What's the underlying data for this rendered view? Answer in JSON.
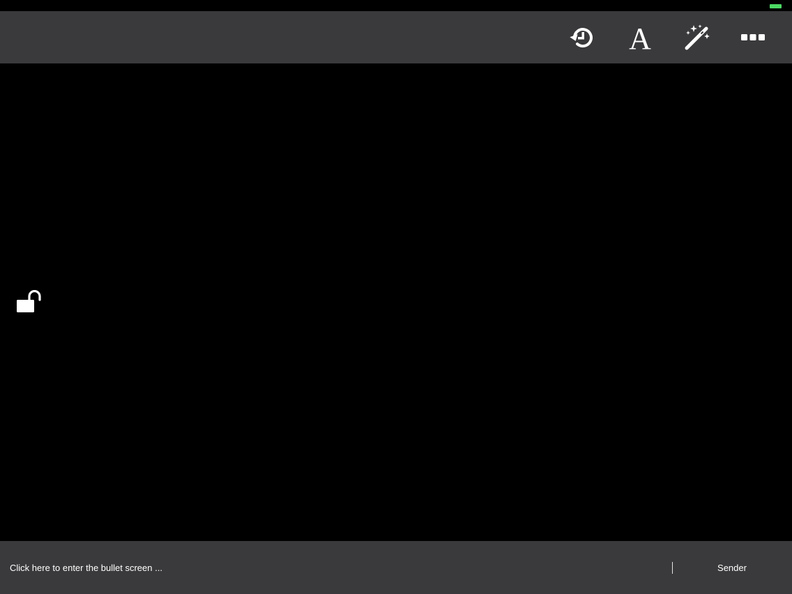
{
  "status_bar": {
    "battery_color": "#4cd964"
  },
  "toolbar": {
    "buttons": [
      {
        "icon": "history-icon"
      },
      {
        "icon": "font-icon",
        "glyph": "A"
      },
      {
        "icon": "magic-wand-icon"
      },
      {
        "icon": "more-icon"
      }
    ]
  },
  "canvas": {
    "lock_icon": "unlocked-padlock-icon"
  },
  "input_bar": {
    "placeholder": "Click here to enter the bullet screen ...",
    "send_label": "Sender"
  },
  "colors": {
    "background": "#000000",
    "bar": "#3a3a3c",
    "text": "#ffffff"
  }
}
